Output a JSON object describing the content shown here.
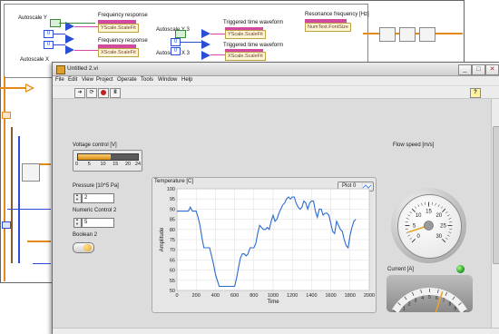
{
  "diagram": {
    "labels": {
      "autoscale_y": "Autoscale Y",
      "autoscale_x": "Autoscale X",
      "autoscale_y3": "Autoscale Y 3",
      "autoscale_x3": "Autoscale X 3",
      "freq_response_1": "Frequency response",
      "freq_response_2": "Frequency response",
      "triggered_1": "Triggered time waveform",
      "triggered_2": "Triggered time waveform",
      "resonance": "Resonance frequency [Hz]"
    },
    "constants": {
      "c1": "0",
      "c2": "0",
      "c3": "0",
      "c4": "0"
    },
    "props": {
      "yscale_fit": "YScale.ScaleFit",
      "xscale_fit": "XScale.ScaleFit",
      "yscale_fit2": "YScale.ScaleFit",
      "xscale_fit2": "XScale.ScaleFit",
      "num_text": "NumText.FontSize"
    }
  },
  "window": {
    "title": "Untitled 2.vi",
    "menu": [
      "File",
      "Edit",
      "View",
      "Project",
      "Operate",
      "Tools",
      "Window",
      "Help"
    ],
    "buttons": {
      "minimize": "_",
      "maximize": "□",
      "close": "✕"
    }
  },
  "toolbar": {
    "run_icon": "run-arrow-icon",
    "run_continuous_icon": "run-continuous-icon",
    "abort_icon": "abort-icon",
    "pause_icon": "pause-icon",
    "help_icon": "context-help-icon"
  },
  "panel": {
    "voltage": {
      "label": "Voltage control [V]",
      "ticks": [
        "0",
        "5",
        "10",
        "15",
        "20",
        "24"
      ],
      "value": 13,
      "max": 24
    },
    "pressure": {
      "label": "Pressure [10^5 Pa]",
      "value": "2"
    },
    "numeric2": {
      "label": "Numeric Control 2",
      "value": "5"
    },
    "boolean2": {
      "label": "Boolean 2",
      "state": true
    },
    "graph": {
      "title": "Temperature [C]",
      "legend": "Plot 0"
    },
    "flow": {
      "label": "Flow speed [m/s]",
      "ticks": [
        "0",
        "5",
        "10",
        "15",
        "20",
        "25",
        "30"
      ],
      "value": 3
    },
    "current": {
      "label": "Current [A]",
      "ticks": [
        "0",
        "1",
        "2",
        "3",
        "4",
        "5",
        "6",
        "7",
        "8",
        "9",
        "10"
      ],
      "value": 6.5
    },
    "colors": {
      "accent": "#e8a428",
      "plot_line": "#2a6ad0",
      "led_on": "#2aa02a"
    }
  },
  "chart_data": {
    "type": "line",
    "title": "",
    "xlabel": "Time",
    "ylabel": "Amplitude",
    "xlim": [
      0,
      2000
    ],
    "ylim": [
      50,
      100
    ],
    "xticks": [
      0,
      200,
      400,
      600,
      800,
      1000,
      1200,
      1400,
      1600,
      1800,
      2000
    ],
    "yticks": [
      50,
      55,
      60,
      65,
      70,
      75,
      80,
      85,
      90,
      95,
      100
    ],
    "grid": true,
    "series": [
      {
        "name": "Plot 0",
        "x": [
          0,
          120,
          140,
          160,
          180,
          200,
          220,
          240,
          260,
          280,
          300,
          320,
          340,
          360,
          380,
          400,
          420,
          440,
          460,
          480,
          500,
          520,
          540,
          560,
          580,
          600,
          620,
          640,
          660,
          680,
          700,
          720,
          740,
          760,
          780,
          800,
          820,
          840,
          860,
          880,
          900,
          920,
          940,
          960,
          980,
          1000,
          1020,
          1040,
          1060,
          1080,
          1100,
          1120,
          1140,
          1160,
          1180,
          1200,
          1220,
          1240,
          1260,
          1280,
          1300,
          1320,
          1340,
          1360,
          1380,
          1400,
          1420,
          1440,
          1460,
          1480,
          1500,
          1520,
          1540,
          1560,
          1580,
          1600,
          1620,
          1640,
          1660,
          1680,
          1700,
          1720,
          1740,
          1760,
          1780,
          1800,
          1820,
          1840,
          1860
        ],
        "y": [
          89,
          89,
          91,
          89,
          89,
          89,
          86,
          82,
          76,
          71,
          71,
          71,
          71,
          67,
          63,
          58,
          55,
          52,
          52,
          52,
          52,
          52,
          52,
          52,
          52,
          52,
          56,
          61,
          66,
          68,
          68,
          67,
          68,
          71,
          71,
          71,
          73,
          78,
          82,
          81,
          80,
          80,
          81,
          80,
          84,
          87,
          84,
          85,
          88,
          90,
          92,
          93,
          95,
          96,
          95,
          96,
          96,
          93,
          91,
          90,
          91,
          94,
          93,
          90,
          93,
          94,
          94,
          89,
          86,
          90,
          90,
          87,
          88,
          88,
          87,
          83,
          79,
          78,
          84,
          82,
          80,
          79,
          75,
          72,
          71,
          77,
          81,
          84,
          85
        ]
      }
    ]
  }
}
